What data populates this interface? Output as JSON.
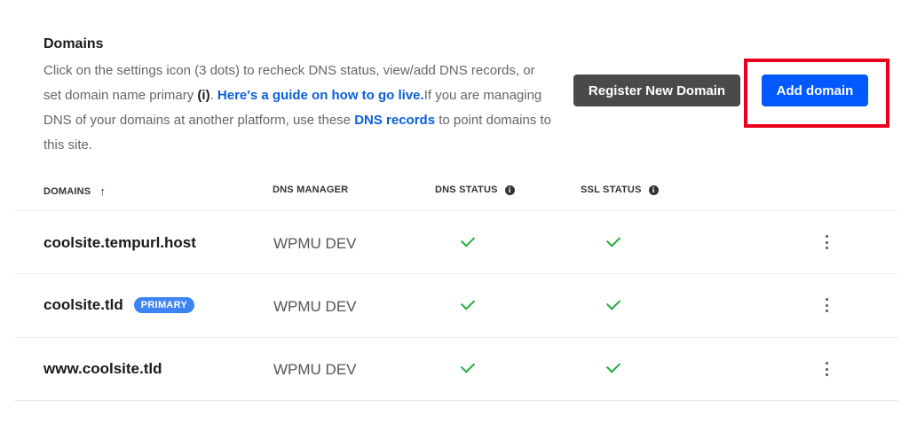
{
  "header": {
    "title": "Domains",
    "desc_1": "Click on the settings icon (3 dots) to recheck DNS status, view/add DNS records, or set domain name primary ",
    "desc_bold": "(i)",
    "desc_2": ". ",
    "guide_link": "Here's a guide on how to go live.",
    "desc_3": "If you are managing DNS of your domains at another platform, use these ",
    "dns_link": "DNS records",
    "desc_4": " to point domains to this site."
  },
  "actions": {
    "register_label": "Register New Domain",
    "add_label": "Add domain"
  },
  "table": {
    "columns": {
      "domains": "DOMAINS",
      "dns_manager": "DNS MANAGER",
      "dns_status": "DNS STATUS",
      "ssl_status": "SSL STATUS"
    },
    "sort_icon": "arrow-up-icon",
    "rows": [
      {
        "domain": "coolsite.tempurl.host",
        "badge": "",
        "manager": "WPMU DEV",
        "dns_ok": true,
        "ssl_ok": true
      },
      {
        "domain": "coolsite.tld",
        "badge": "PRIMARY",
        "manager": "WPMU DEV",
        "dns_ok": true,
        "ssl_ok": true
      },
      {
        "domain": "www.coolsite.tld",
        "badge": "",
        "manager": "WPMU DEV",
        "dns_ok": true,
        "ssl_ok": true
      }
    ]
  },
  "colors": {
    "primary": "#0259ff",
    "dark_button": "#4a4a4a",
    "badge": "#3d84f5",
    "success": "#1fae3a",
    "link": "#0a5fd9",
    "highlight": "#e8001c"
  }
}
